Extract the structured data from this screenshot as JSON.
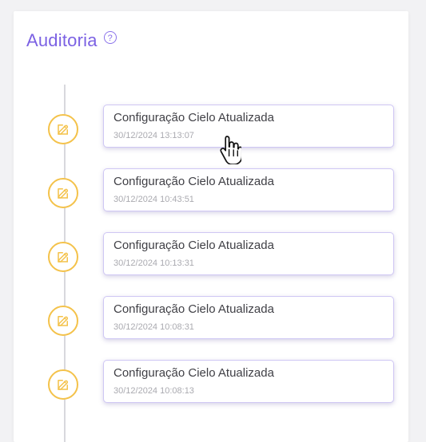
{
  "header": {
    "title": "Auditoria",
    "help_icon": "question-circle-icon",
    "help_symbol": "?"
  },
  "timeline": {
    "marker_icon": "edit-square-icon",
    "items": [
      {
        "title": "Configuração Cielo Atualizada",
        "date": "30/12/2024 13:13:07"
      },
      {
        "title": "Configuração Cielo Atualizada",
        "date": "30/12/2024 10:43:51"
      },
      {
        "title": "Configuração Cielo Atualizada",
        "date": "30/12/2024 10:13:31"
      },
      {
        "title": "Configuração Cielo Atualizada",
        "date": "30/12/2024 10:08:31"
      },
      {
        "title": "Configuração Cielo Atualizada",
        "date": "30/12/2024 10:08:13"
      }
    ]
  },
  "colors": {
    "accent": "#7b61e3",
    "marker": "#f4c24a",
    "card_border": "#cfc7f4",
    "timeline_line": "#d8d8dd"
  },
  "cursor": {
    "icon": "hand-pointer-icon"
  }
}
